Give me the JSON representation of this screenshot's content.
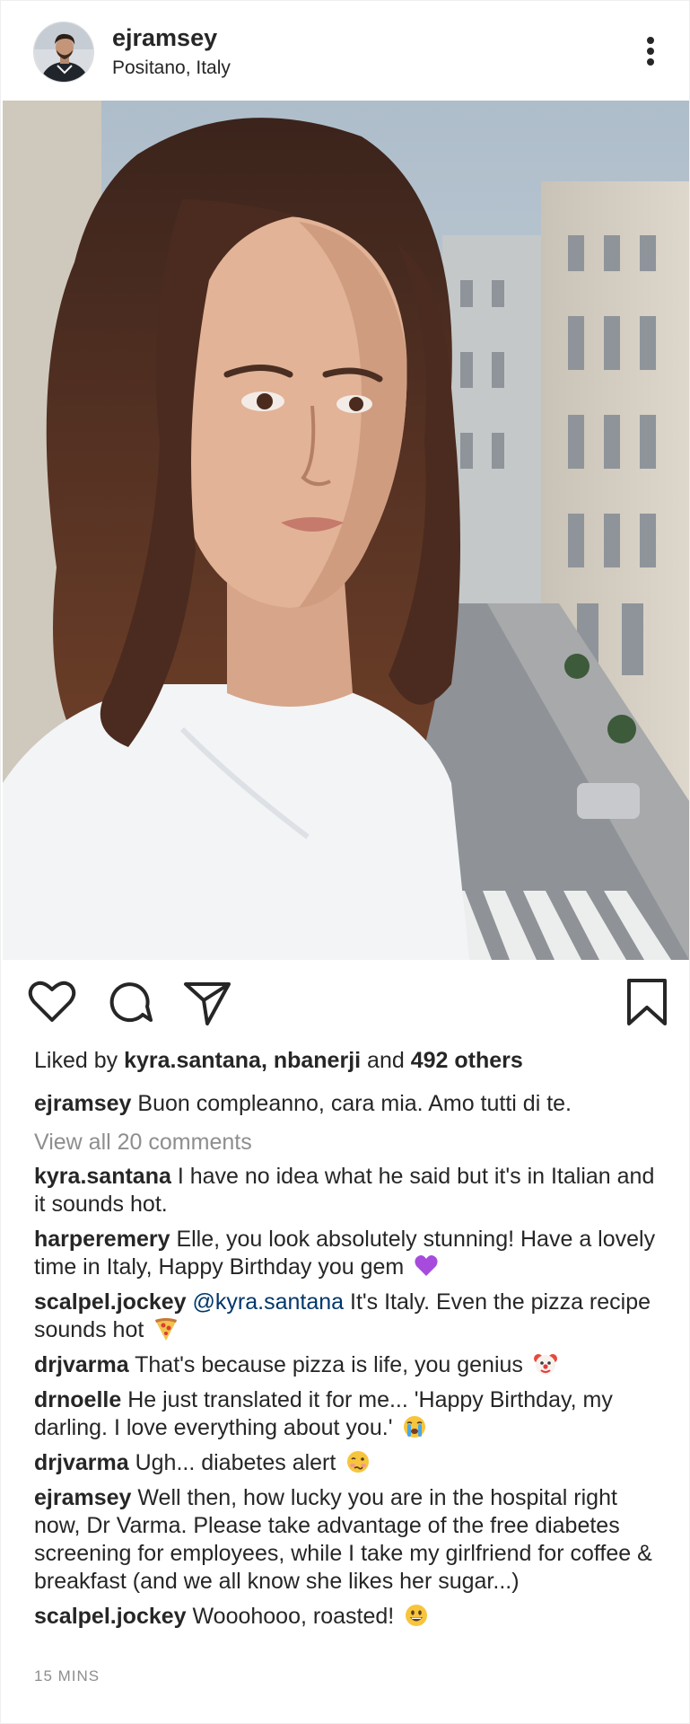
{
  "header": {
    "username": "ejramsey",
    "location": "Positano, Italy"
  },
  "likes": {
    "prefix": "Liked by",
    "users": "kyra.santana, nbanerji",
    "joiner": "and",
    "others": "492 others"
  },
  "caption": {
    "username": "ejramsey",
    "text": "Buon compleanno, cara mia. Amo tutti di te."
  },
  "view_all": "View all 20 comments",
  "comments": [
    {
      "username": "kyra.santana",
      "text": "I have no idea what he said but it's in Italian and it sounds hot."
    },
    {
      "username": "harperemery",
      "text": "Elle, you look absolutely stunning! Have a lovely time in Italy, Happy Birthday you gem",
      "emoji": "purple-heart-emoji"
    },
    {
      "username": "scalpel.jockey",
      "mention": "@kyra.santana",
      "text": "It's Italy. Even the pizza recipe sounds hot",
      "emoji": "pizza-emoji"
    },
    {
      "username": "drjvarma",
      "text": "That's because pizza is life, you genius",
      "emoji": "clown-face-emoji"
    },
    {
      "username": "drnoelle",
      "text": "He just translated it for me... 'Happy Birthday, my darling. I love everything about you.'",
      "emoji": "loudly-crying-emoji"
    },
    {
      "username": "drjvarma",
      "text": "Ugh... diabetes alert",
      "emoji": "woozy-face-emoji"
    },
    {
      "username": "ejramsey",
      "text": "Well then, how lucky you are in the hospital right now, Dr Varma. Please take advantage of the free diabetes screening for employees, while I take my girlfriend for coffee & breakfast (and we all know she likes her sugar...)"
    },
    {
      "username": "scalpel.jockey",
      "text": "Wooohooo, roasted!",
      "emoji": "grinning-face-emoji"
    }
  ],
  "timestamp": "15 MINS",
  "icons": {
    "more": "more-options-icon",
    "like": "heart-icon",
    "comment": "comment-bubble-icon",
    "share": "paper-plane-icon",
    "save": "bookmark-icon"
  },
  "colors": {
    "text": "#262626",
    "secondary": "#8e8e8e",
    "mention": "#00376b"
  }
}
